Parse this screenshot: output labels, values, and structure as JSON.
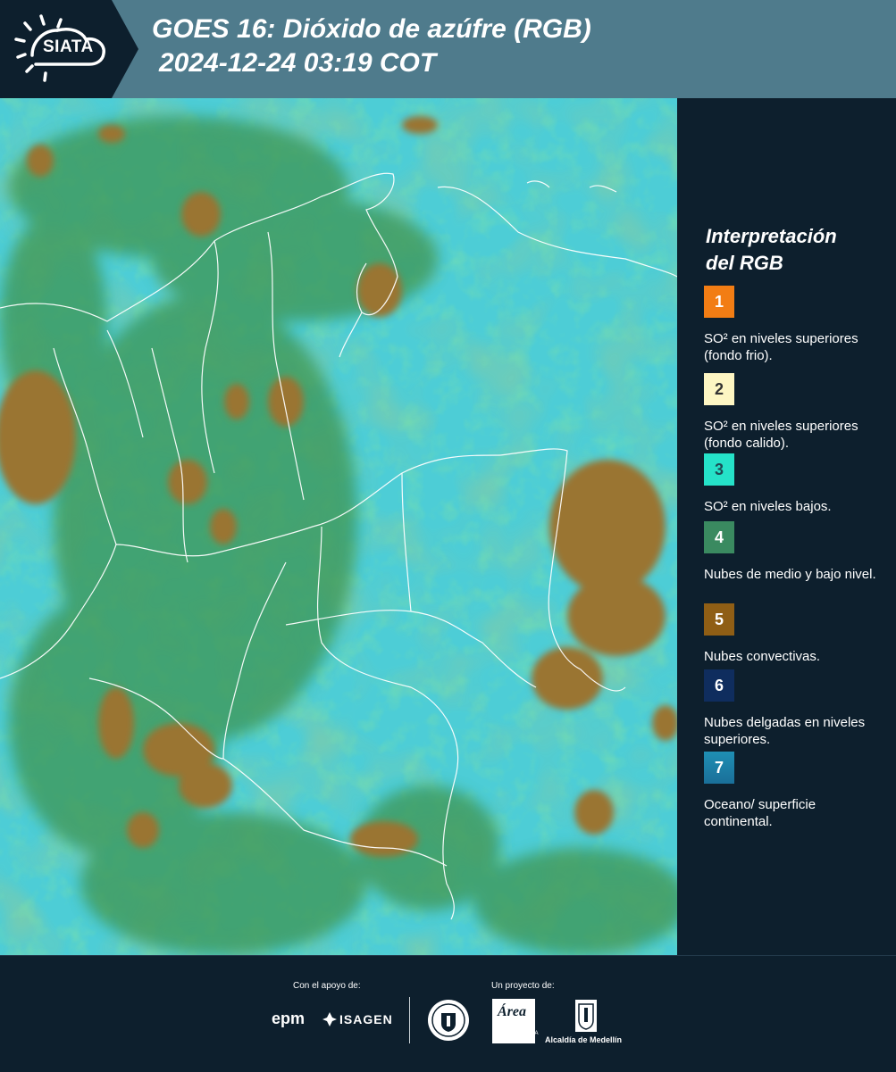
{
  "header": {
    "logo_text": "SIATA",
    "title_line1": "GOES 16: Dióxido de azúfre (RGB)",
    "title_line2": "2024-12-24 03:19 COT"
  },
  "legend": {
    "title_line1": "Interpretación",
    "title_line2": "del RGB",
    "items": [
      {
        "number": "1",
        "color": "#f27d14",
        "text_color": "#ffffff",
        "text": "SO² en niveles superiores (fondo frio)."
      },
      {
        "number": "2",
        "color": "#fdf6c3",
        "text_color": "#333333",
        "text": "SO² en niveles superiores (fondo calido)."
      },
      {
        "number": "3",
        "color": "#25e2c9",
        "text_color": "#1f4a55",
        "text": "SO² en niveles bajos."
      },
      {
        "number": "4",
        "color": "#3a8a60",
        "text_color": "#ffffff",
        "text": "Nubes de medio y bajo nivel."
      },
      {
        "number": "5",
        "color": "#8f5e15",
        "text_color": "#ffffff",
        "text": "Nubes convectivas."
      },
      {
        "number": "6",
        "color": "#0f2d5e",
        "text_color": "#ffffff",
        "text": "Nubes delgadas en niveles superiores."
      },
      {
        "number": "7",
        "color": "#1f8fb4",
        "text_color": "#ffffff",
        "text": "Oceano/ superficie continental."
      }
    ]
  },
  "footer": {
    "support_label": "Con el apoyo de:",
    "project_label": "Un proyecto de:",
    "sponsor1": "epm",
    "sponsor2": "ISAGEN",
    "area_logo_text": "Área",
    "area_caption": "METROPOLITANA Valle de Aburrá",
    "alcaldia": "Alcaldía de Medellín"
  },
  "map": {
    "image_type": "satellite-rgb-so2",
    "colors": {
      "background": "#33c6d2",
      "cloud_green": "#3f9a55",
      "convective": "#9a7430",
      "boundaries": "#ffffff"
    }
  }
}
